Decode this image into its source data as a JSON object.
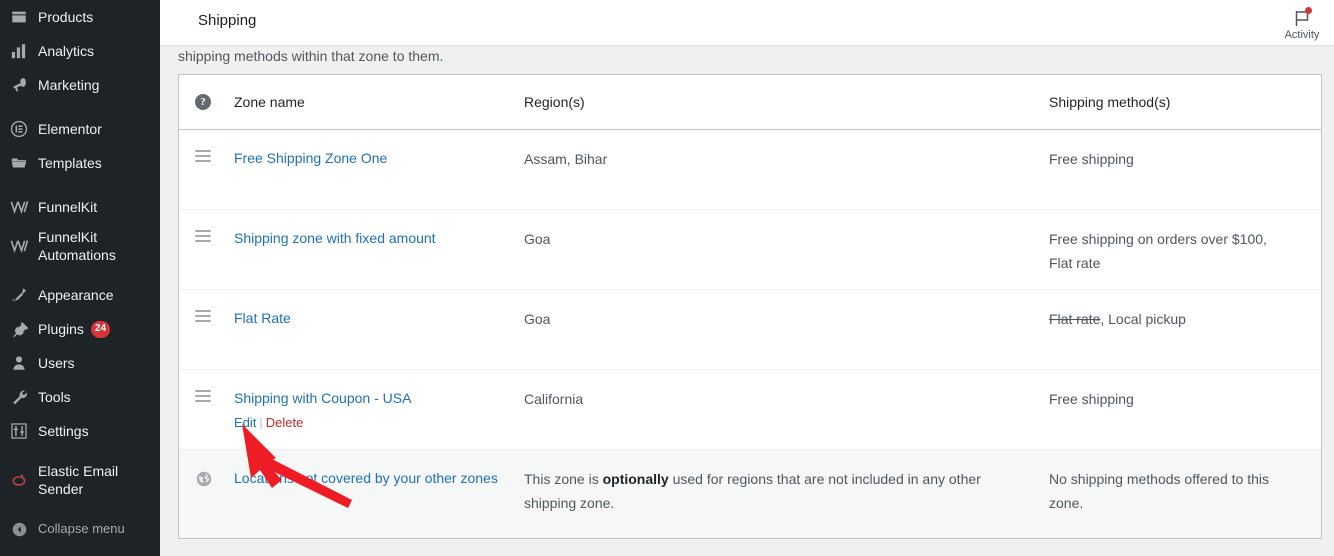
{
  "sidebar": {
    "items": [
      {
        "label": "Products",
        "icon": "products-icon",
        "badge": null
      },
      {
        "label": "Analytics",
        "icon": "analytics-icon",
        "badge": null
      },
      {
        "label": "Marketing",
        "icon": "marketing-icon",
        "badge": null
      },
      {
        "label": "Elementor",
        "icon": "elementor-icon",
        "badge": null
      },
      {
        "label": "Templates",
        "icon": "templates-icon",
        "badge": null
      },
      {
        "label": "FunnelKit",
        "icon": "funnelkit-icon",
        "badge": null
      },
      {
        "label": "FunnelKit\nAutomations",
        "icon": "funnelkit-automations-icon",
        "badge": null
      },
      {
        "label": "Appearance",
        "icon": "appearance-icon",
        "badge": null
      },
      {
        "label": "Plugins",
        "icon": "plugins-icon",
        "badge": "24"
      },
      {
        "label": "Users",
        "icon": "users-icon",
        "badge": null
      },
      {
        "label": "Tools",
        "icon": "tools-icon",
        "badge": null
      },
      {
        "label": "Settings",
        "icon": "settings-icon",
        "badge": null
      },
      {
        "label": "Elastic Email\nSender",
        "icon": "elastic-email-icon",
        "badge": null
      }
    ],
    "collapse_label": "Collapse menu"
  },
  "header": {
    "title": "Shipping",
    "activity_label": "Activity"
  },
  "main": {
    "intro_text": "shipping methods within that zone to them.",
    "table": {
      "columns": {
        "help": "?",
        "zone_name": "Zone name",
        "regions": "Region(s)",
        "methods": "Shipping method(s)"
      },
      "rows": [
        {
          "handle": "drag-handle",
          "name": "Free Shipping Zone One",
          "regions": "Assam, Bihar",
          "methods": [
            {
              "text": "Free shipping",
              "struck": false
            }
          ],
          "actions_visible": false
        },
        {
          "handle": "drag-handle",
          "name": "Shipping zone with fixed amount",
          "regions": "Goa",
          "methods": [
            {
              "text": "Free shipping on orders over $100,",
              "struck": false
            },
            {
              "text": "Flat rate",
              "struck": false
            }
          ],
          "actions_visible": false
        },
        {
          "handle": "drag-handle",
          "name": "Flat Rate",
          "regions": "Goa",
          "methods": [
            {
              "text": "Flat rate",
              "struck": true
            },
            {
              "text": ", Local pickup",
              "struck": false
            }
          ],
          "actions_visible": false
        },
        {
          "handle": "drag-handle",
          "name": "Shipping with Coupon - USA",
          "regions": "California",
          "methods": [
            {
              "text": "Free shipping",
              "struck": false
            }
          ],
          "actions_visible": true,
          "edit_label": "Edit",
          "separator": "|",
          "delete_label": "Delete"
        },
        {
          "handle": "globe-icon",
          "name": "Locations not covered by your other zones",
          "regions_rich": {
            "before": "This zone is ",
            "bold": "optionally",
            "after": " used for regions that are not included in any other shipping zone."
          },
          "methods": [
            {
              "text": "No shipping methods offered to this zone.",
              "struck": false
            }
          ],
          "actions_visible": false,
          "worldwide": true
        }
      ]
    }
  },
  "annotation": {
    "type": "arrow",
    "color": "#ee1c25",
    "points_to": "edit-link"
  },
  "colors": {
    "sidebar_bg": "#1d2327",
    "link": "#2271b1",
    "delete": "#b32d2e",
    "badge": "#d63638",
    "page_bg": "#f0f0f1",
    "annotation": "#ee1c25"
  }
}
